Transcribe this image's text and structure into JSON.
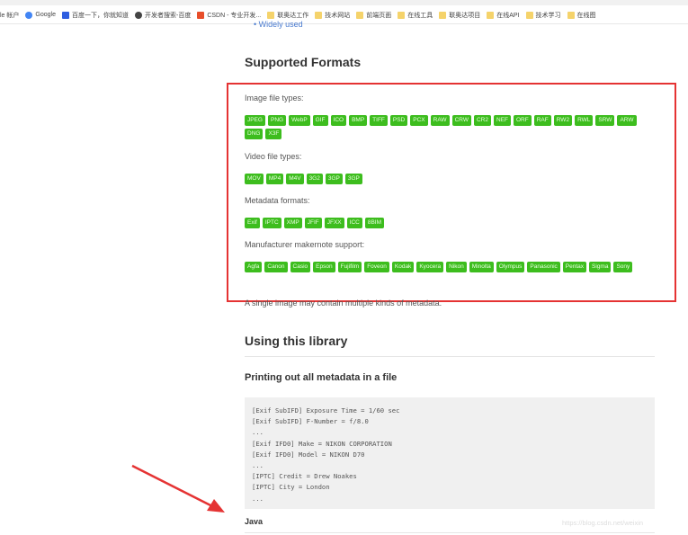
{
  "bookmarks": [
    {
      "label": "le 帐户",
      "icon": "account-icon",
      "color": ""
    },
    {
      "label": "Google",
      "icon": "google-icon",
      "color": "#4285f4"
    },
    {
      "label": "百度一下，你就知道",
      "icon": "baidu-icon",
      "color": "#2f5ee0"
    },
    {
      "label": "开发者搜索-百度",
      "icon": "globe-icon",
      "color": "#444444"
    },
    {
      "label": "CSDN - 专业开发...",
      "icon": "csdn-icon",
      "color": "#e84e2a"
    },
    {
      "label": "联奥达工作",
      "icon": "folder-icon",
      "color": "#f5d36b"
    },
    {
      "label": "技术网站",
      "icon": "folder-icon",
      "color": "#f5d36b"
    },
    {
      "label": "前端页面",
      "icon": "folder-icon",
      "color": "#f5d36b"
    },
    {
      "label": "在线工具",
      "icon": "folder-icon",
      "color": "#f5d36b"
    },
    {
      "label": "联奥达项目",
      "icon": "folder-icon",
      "color": "#f5d36b"
    },
    {
      "label": "在线API",
      "icon": "folder-icon",
      "color": "#f5d36b"
    },
    {
      "label": "技术学习",
      "icon": "folder-icon",
      "color": "#f5d36b"
    },
    {
      "label": "在线图",
      "icon": "folder-icon",
      "color": "#f5d36b"
    }
  ],
  "page": {
    "widely_used": "Widely used",
    "supported_formats": "Supported Formats",
    "image_label": "Image file types:",
    "image_tags": [
      "JPEG",
      "PNG",
      "WebP",
      "GIF",
      "ICO",
      "BMP",
      "TIFF",
      "PSD",
      "PCX",
      "RAW",
      "CRW",
      "CR2",
      "NEF",
      "ORF",
      "RAF",
      "RW2",
      "RWL",
      "SRW",
      "ARW",
      "DNG",
      "X3F"
    ],
    "video_label": "Video file types:",
    "video_tags": [
      "MOV",
      "MP4",
      "M4V",
      "3G2",
      "3GP",
      "3GP"
    ],
    "meta_label": "Metadata formats:",
    "meta_tags": [
      "Exif",
      "IPTC",
      "XMP",
      "JFIF",
      "JFXX",
      "ICC",
      "8BIM"
    ],
    "maker_label": "Manufacturer makernote support:",
    "maker_tags": [
      "Agfa",
      "Canon",
      "Casio",
      "Epson",
      "Fujifilm",
      "Foveon",
      "Kodak",
      "Kyocera",
      "Nikon",
      "Minolta",
      "Olympus",
      "Panasonic",
      "Pentax",
      "Sigma",
      "Sony"
    ],
    "single_image": "A single image may contain multiple kinds of metadata.",
    "using": "Using this library",
    "printing": "Printing out all metadata in a file",
    "code": "[Exif SubIFD] Exposure Time = 1/60 sec\n[Exif SubIFD] F-Number = f/8.0\n...\n[Exif IFD0] Make = NIKON CORPORATION\n[Exif IFD0] Model = NIKON D70\n...\n[IPTC] Credit = Drew Noakes\n[IPTC] City = London\n...",
    "java": "Java"
  },
  "colors": {
    "tag": "#3dbd1e",
    "highlight_box": "#e53333",
    "arrow": "#e53333"
  },
  "watermark": "https://blog.csdn.net/weixin"
}
